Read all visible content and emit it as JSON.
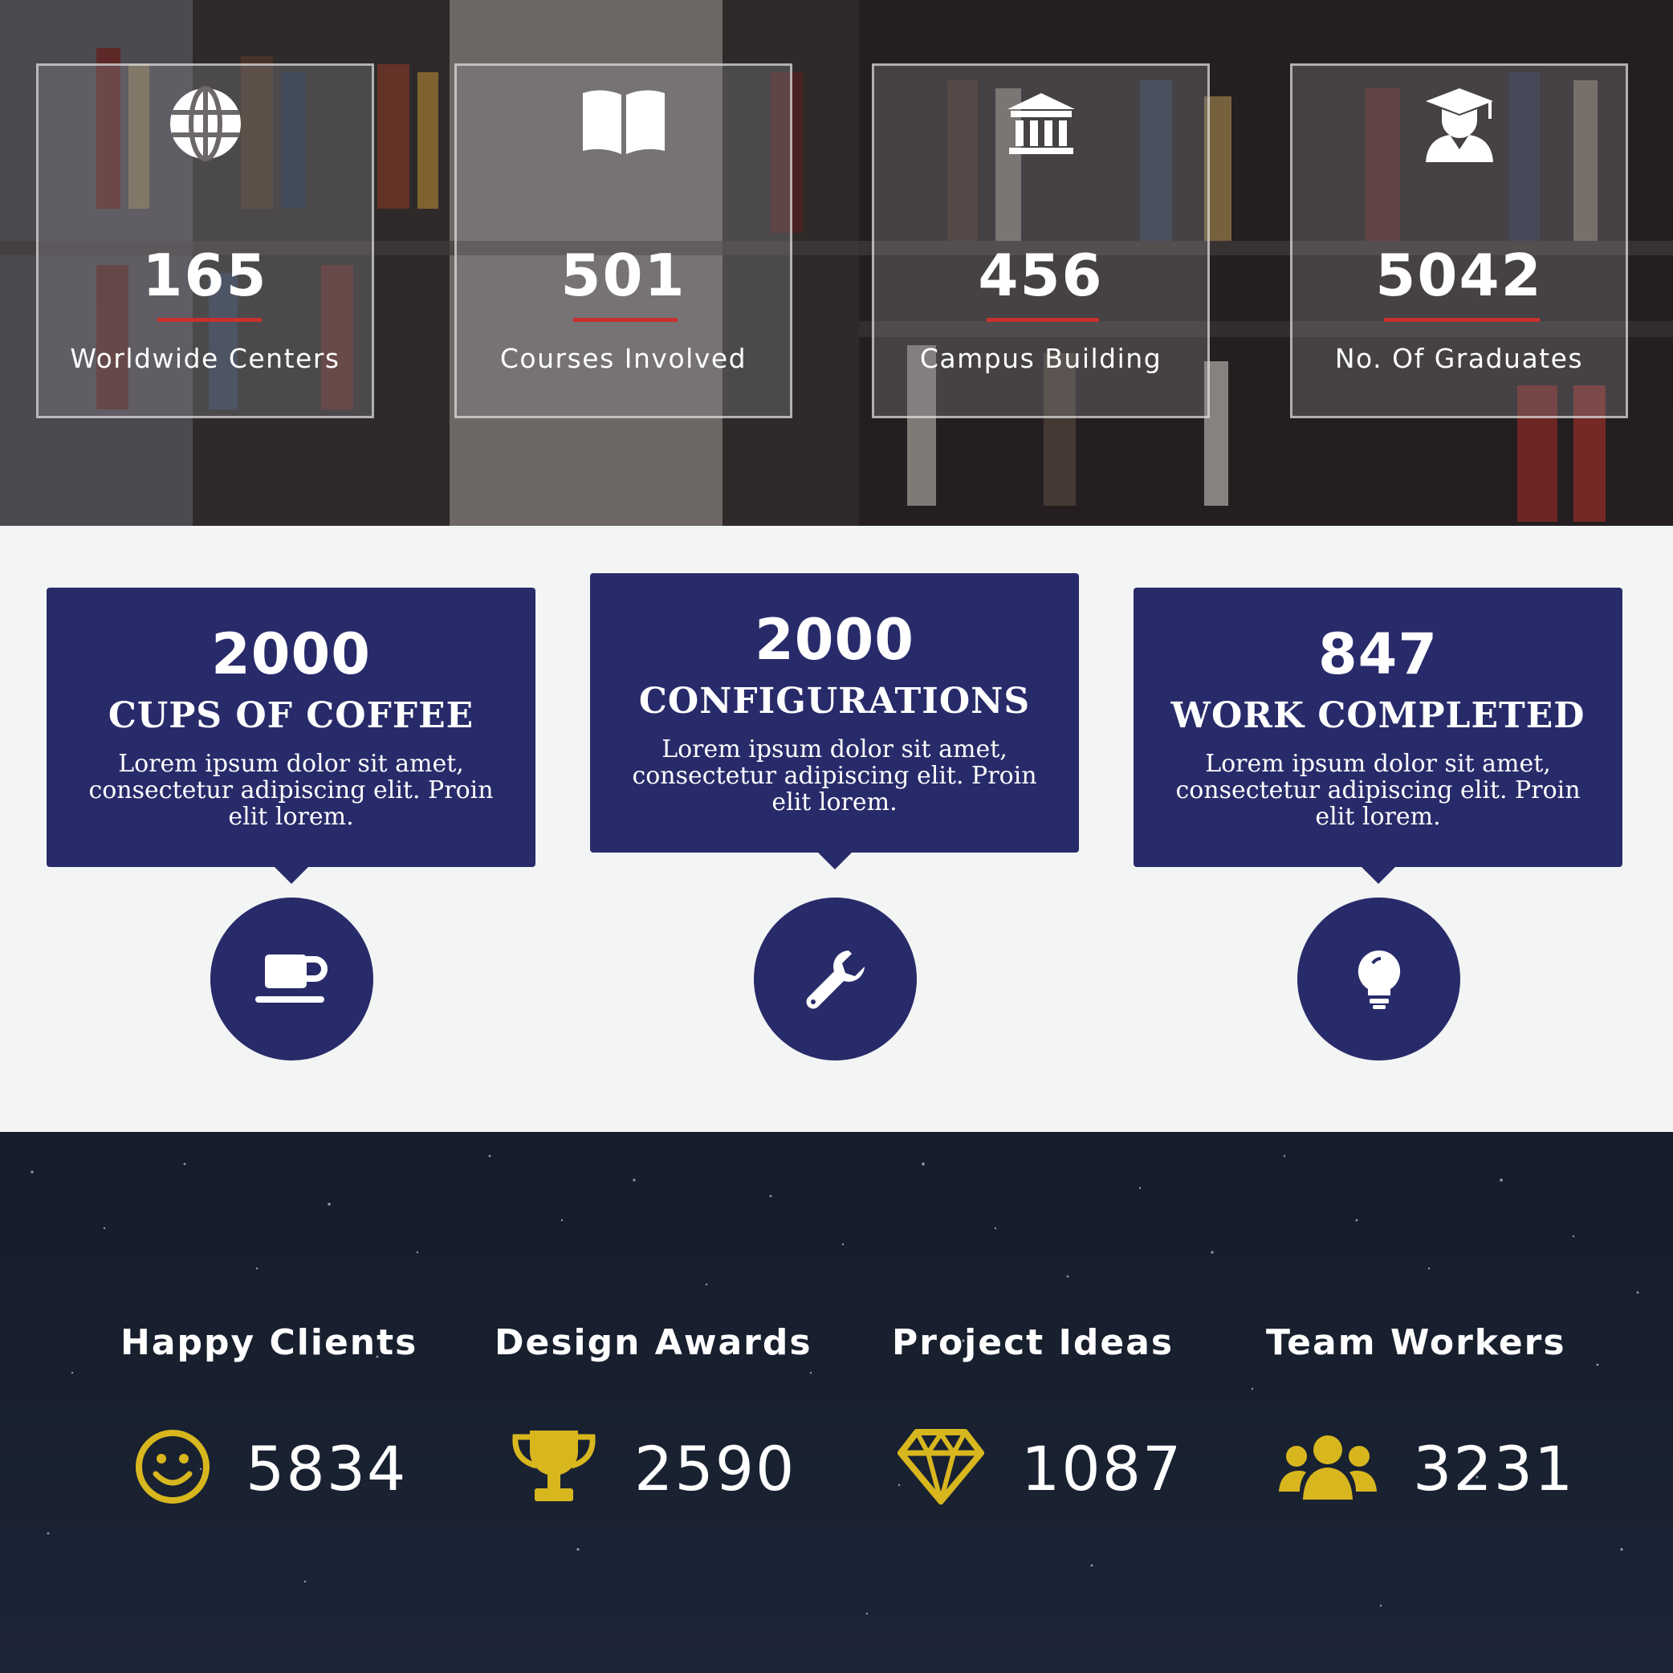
{
  "library_stats": [
    {
      "icon": "globe-icon",
      "value": "165",
      "label": "Worldwide Centers"
    },
    {
      "icon": "open-book-icon",
      "value": "501",
      "label": "Courses Involved"
    },
    {
      "icon": "institution-icon",
      "value": "456",
      "label": "Campus Building"
    },
    {
      "icon": "graduate-icon",
      "value": "5042",
      "label": "No. Of Graduates"
    }
  ],
  "callouts": [
    {
      "value": "2000",
      "title": "CUPS OF COFFEE",
      "text": "Lorem ipsum dolor sit amet, consectetur adipiscing elit. Proin elit lorem.",
      "icon": "coffee-cup-icon"
    },
    {
      "value": "2000",
      "title": "CONFIGURATIONS",
      "text": "Lorem ipsum dolor sit amet, consectetur adipiscing elit. Proin elit lorem.",
      "icon": "wrench-icon"
    },
    {
      "value": "847",
      "title": "WORK COMPLETED",
      "text": "Lorem ipsum dolor sit amet, consectetur adipiscing elit. Proin elit lorem.",
      "icon": "lightbulb-icon"
    }
  ],
  "counters": [
    {
      "title": "Happy Clients",
      "value": "5834",
      "icon": "smiley-icon"
    },
    {
      "title": "Design Awards",
      "value": "2590",
      "icon": "trophy-icon"
    },
    {
      "title": "Project Ideas",
      "value": "1087",
      "icon": "diamond-icon"
    },
    {
      "title": "Team Workers",
      "value": "3231",
      "icon": "users-icon"
    }
  ],
  "colors": {
    "navy": "#282b6a",
    "accent_red": "#c9302c",
    "gold": "#d8b71e",
    "light_bg": "#f3f4f4",
    "night_bg": "#18202f"
  }
}
